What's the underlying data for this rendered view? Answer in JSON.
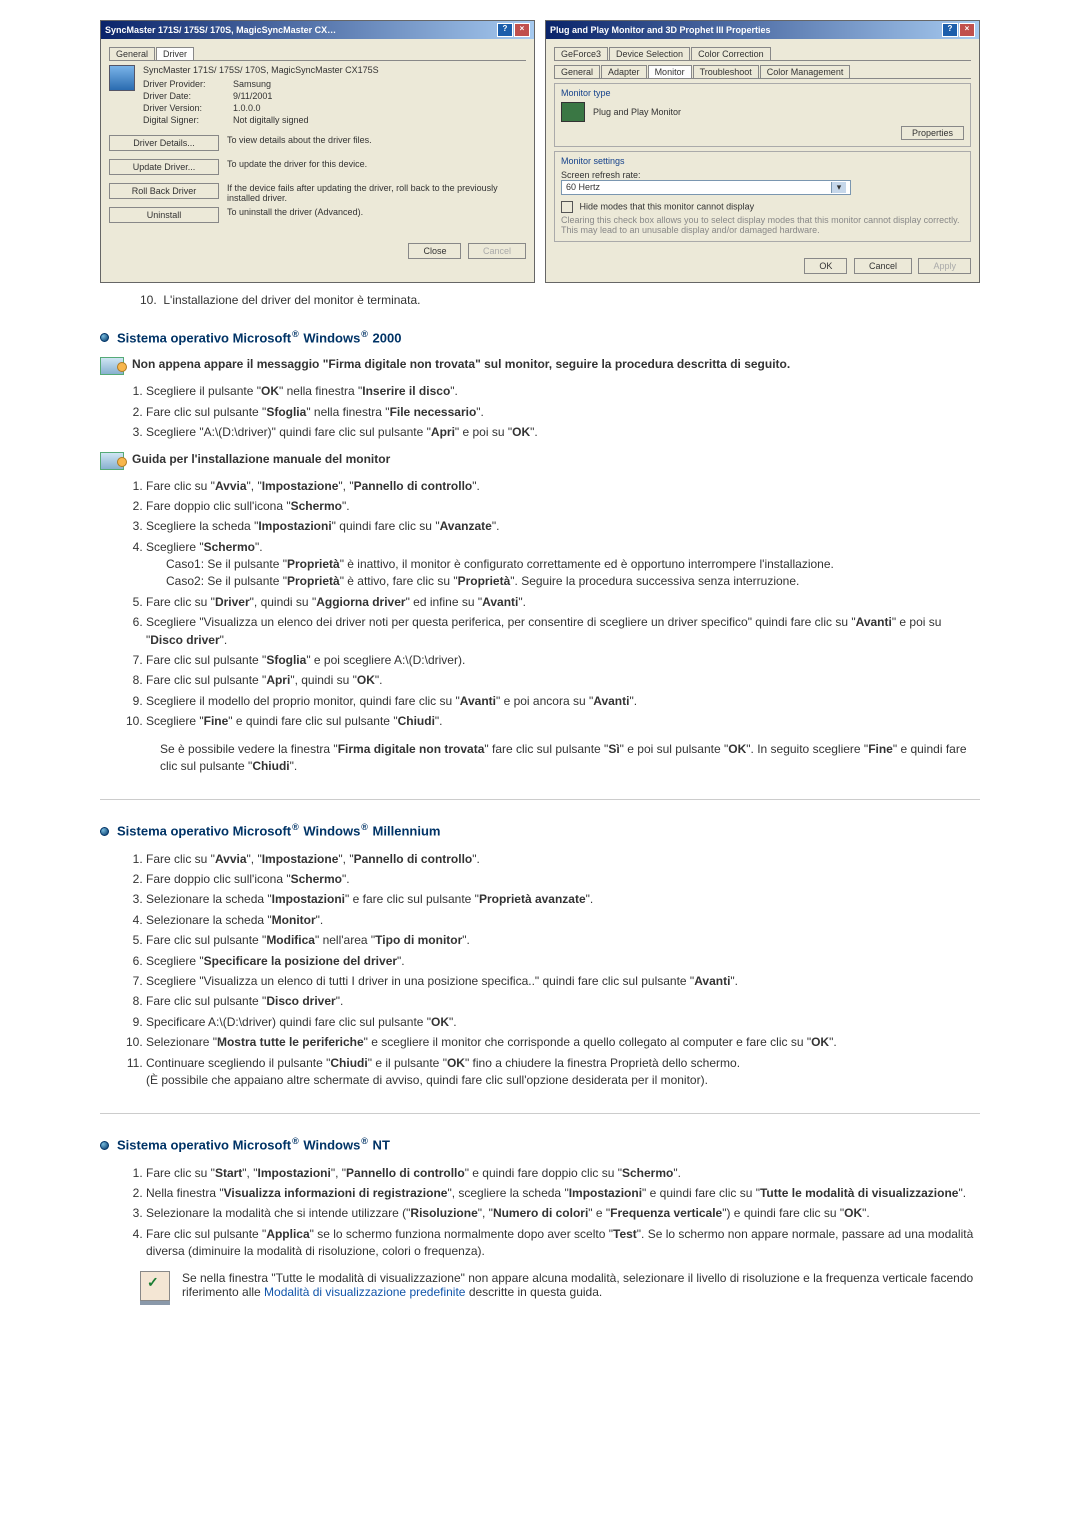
{
  "dialog1": {
    "title": "SyncMaster 171S/ 175S/ 170S, MagicSyncMaster CX…",
    "tab_general": "General",
    "tab_driver": "Driver",
    "device_name": "SyncMaster 171S/ 175S/ 170S, MagicSyncMaster CX175S",
    "provider_label": "Driver Provider:",
    "provider_val": "Samsung",
    "date_label": "Driver Date:",
    "date_val": "9/11/2001",
    "version_label": "Driver Version:",
    "version_val": "1.0.0.0",
    "signer_label": "Digital Signer:",
    "signer_val": "Not digitally signed",
    "btn_details": "Driver Details...",
    "btn_details_desc": "To view details about the driver files.",
    "btn_update": "Update Driver...",
    "btn_update_desc": "To update the driver for this device.",
    "btn_rollback": "Roll Back Driver",
    "btn_rollback_desc": "If the device fails after updating the driver, roll back to the previously installed driver.",
    "btn_uninstall": "Uninstall",
    "btn_uninstall_desc": "To uninstall the driver (Advanced).",
    "close": "Close",
    "cancel": "Cancel"
  },
  "dialog2": {
    "title": "Plug and Play Monitor and 3D Prophet III Properties",
    "tab_geforce": "GeForce3",
    "tab_devsel": "Device Selection",
    "tab_colorcorr": "Color Correction",
    "tab_general": "General",
    "tab_adapter": "Adapter",
    "tab_monitor": "Monitor",
    "tab_troubleshoot": "Troubleshoot",
    "tab_colormgmt": "Color Management",
    "montype_label": "Monitor type",
    "montype_val": "Plug and Play Monitor",
    "properties_btn": "Properties",
    "monset_label": "Monitor settings",
    "refresh_label": "Screen refresh rate:",
    "refresh_val": "60 Hertz",
    "hide_label": "Hide modes that this monitor cannot display",
    "hide_desc": "Clearing this check box allows you to select display modes that this monitor cannot display correctly. This may lead to an unusable display and/or damaged hardware.",
    "ok": "OK",
    "cancel": "Cancel",
    "apply": "Apply"
  },
  "finish": "L'installazione del driver del monitor è terminata.",
  "finish_num": "10.",
  "win2000": {
    "heading_a": "Sistema operativo Microsoft",
    "heading_b": " Windows",
    "heading_c": " 2000",
    "sub1": "Non appena appare il messaggio \"Firma digitale non trovata\" sul monitor, seguire la procedura descritta di seguito.",
    "s1": {
      "a": "Scegliere il pulsante \"",
      "b": "OK",
      "c": "\" nella finestra \"",
      "d": "Inserire il disco",
      "e": "\"."
    },
    "s2": {
      "a": "Fare clic sul pulsante \"",
      "b": "Sfoglia",
      "c": "\" nella finestra \"",
      "d": "File necessario",
      "e": "\"."
    },
    "s3": {
      "a": "Scegliere \"A:\\(D:\\driver)\" quindi fare clic sul pulsante \"",
      "b": "Apri",
      "c": "\" e poi su \"",
      "d": "OK",
      "e": "\"."
    },
    "sub2": "Guida per l'installazione manuale del monitor",
    "m1": {
      "a": "Fare clic su \"",
      "b": "Avvia",
      "c": "\", \"",
      "d": "Impostazione",
      "e": "\", \"",
      "f": "Pannello di controllo",
      "g": "\"."
    },
    "m2": {
      "a": "Fare doppio clic sull'icona \"",
      "b": "Schermo",
      "c": "\"."
    },
    "m3": {
      "a": "Scegliere la scheda \"",
      "b": "Impostazioni",
      "c": "\" quindi fare clic su \"",
      "d": "Avanzate",
      "e": "\"."
    },
    "m4": {
      "a": "Scegliere \"",
      "b": "Schermo",
      "c": "\"."
    },
    "m4c1": {
      "a": "Caso1: Se il pulsante \"",
      "b": "Proprietà",
      "c": "\" è inattivo, il monitor è configurato correttamente ed è opportuno interrompere l'installazione."
    },
    "m4c2": {
      "a": "Caso2: Se il pulsante \"",
      "b": "Proprietà",
      "c": "\" è attivo, fare clic su \"",
      "d": "Proprietà",
      "e": "\". Seguire la procedura successiva senza interruzione."
    },
    "m5": {
      "a": "Fare clic su \"",
      "b": "Driver",
      "c": "\", quindi su \"",
      "d": "Aggiorna driver",
      "e": "\" ed infine su \"",
      "f": "Avanti",
      "g": "\"."
    },
    "m6": {
      "a": "Scegliere \"Visualizza un elenco dei driver noti per questa periferica, per consentire di scegliere un driver specifico\" quindi fare clic su \"",
      "b": "Avanti",
      "c": "\" e poi su \"",
      "d": "Disco driver",
      "e": "\"."
    },
    "m7": {
      "a": "Fare clic sul pulsante \"",
      "b": "Sfoglia",
      "c": "\" e poi scegliere A:\\(D:\\driver)."
    },
    "m8": {
      "a": "Fare clic sul pulsante \"",
      "b": "Apri",
      "c": "\", quindi su \"",
      "d": "OK",
      "e": "\"."
    },
    "m9": {
      "a": "Scegliere il modello del proprio monitor, quindi fare clic su \"",
      "b": "Avanti",
      "c": "\" e poi ancora su \"",
      "d": "Avanti",
      "e": "\"."
    },
    "m10": {
      "a": "Scegliere \"",
      "b": "Fine",
      "c": "\" e quindi fare clic sul pulsante \"",
      "d": "Chiudi",
      "e": "\"."
    },
    "note": {
      "a": "Se è possibile vedere la finestra \"",
      "b": "Firma digitale non trovata",
      "c": "\" fare clic sul pulsante \"",
      "d": "Sì",
      "e": "\" e poi sul pulsante \"",
      "f": "OK",
      "g": "\". In seguito scegliere \"",
      "h": "Fine",
      "i": "\" e quindi fare clic sul pulsante \"",
      "j": "Chiudi",
      "k": "\"."
    }
  },
  "winme": {
    "heading_a": "Sistema operativo Microsoft",
    "heading_b": " Windows",
    "heading_c": " Millennium",
    "s1": {
      "a": "Fare clic su \"",
      "b": "Avvia",
      "c": "\", \"",
      "d": "Impostazione",
      "e": "\", \"",
      "f": "Pannello di controllo",
      "g": "\"."
    },
    "s2": {
      "a": "Fare doppio clic sull'icona \"",
      "b": "Schermo",
      "c": "\"."
    },
    "s3": {
      "a": "Selezionare la scheda \"",
      "b": "Impostazioni",
      "c": "\" e fare clic sul pulsante \"",
      "d": "Proprietà avanzate",
      "e": "\"."
    },
    "s4": {
      "a": "Selezionare la scheda \"",
      "b": "Monitor",
      "c": "\"."
    },
    "s5": {
      "a": "Fare clic sul pulsante \"",
      "b": "Modifica",
      "c": "\" nell'area \"",
      "d": "Tipo di monitor",
      "e": "\"."
    },
    "s6": {
      "a": "Scegliere \"",
      "b": "Specificare la posizione del driver",
      "c": "\"."
    },
    "s7": {
      "a": "Scegliere \"Visualizza un elenco di tutti I driver in una posizione specifica..\" quindi fare clic sul pulsante \"",
      "b": "Avanti",
      "c": "\"."
    },
    "s8": {
      "a": "Fare clic sul pulsante \"",
      "b": "Disco driver",
      "c": "\"."
    },
    "s9": {
      "a": "Specificare A:\\(D:\\driver) quindi fare clic sul pulsante \"",
      "b": "OK",
      "c": "\"."
    },
    "s10": {
      "a": "Selezionare \"",
      "b": "Mostra tutte le periferiche",
      "c": "\" e scegliere il monitor che corrisponde a quello collegato al computer e fare clic su \"",
      "d": "OK",
      "e": "\"."
    },
    "s11": {
      "a": "Continuare scegliendo il pulsante \"",
      "b": "Chiudi",
      "c": "\" e il pulsante \"",
      "d": "OK",
      "e": "\" fino a chiudere la finestra Proprietà dello schermo."
    },
    "s11b": "(È possibile che appaiano altre schermate di avviso, quindi fare clic sull'opzione desiderata per il monitor)."
  },
  "winnt": {
    "heading_a": "Sistema operativo Microsoft",
    "heading_b": " Windows",
    "heading_c": " NT",
    "s1": {
      "a": "Fare clic su \"",
      "b": "Start",
      "c": "\", \"",
      "d": "Impostazioni",
      "e": "\", \"",
      "f": "Pannello di controllo",
      "g": "\" e quindi fare doppio clic su \"",
      "h": "Schermo",
      "i": "\"."
    },
    "s2": {
      "a": "Nella finestra \"",
      "b": "Visualizza informazioni di registrazione",
      "c": "\", scegliere la scheda \"",
      "d": "Impostazioni",
      "e": "\" e quindi fare clic su \"",
      "f": "Tutte le modalità di visualizzazione",
      "g": "\"."
    },
    "s3": {
      "a": "Selezionare la modalità che si intende utilizzare (\"",
      "b": "Risoluzione",
      "c": "\", \"",
      "d": "Numero di colori",
      "e": "\" e \"",
      "f": "Frequenza verticale",
      "g": "\") e quindi fare clic su \"",
      "h": "OK",
      "i": "\"."
    },
    "s4": {
      "a": "Fare clic sul pulsante \"",
      "b": "Applica",
      "c": "\" se lo schermo funziona normalmente dopo aver scelto \"",
      "d": "Test",
      "e": "\". Se lo schermo non appare normale, passare ad una modalità diversa (diminuire la modalità di risoluzione, colori o frequenza)."
    },
    "note1": "Se nella finestra \"Tutte le modalità di visualizzazione\" non appare alcuna modalità, selezionare il livello di risoluzione e la frequenza verticale facendo riferimento alle ",
    "link": "Modalità di visualizzazione predefinite",
    "note2": " descritte in questa guida."
  },
  "reg": "®"
}
